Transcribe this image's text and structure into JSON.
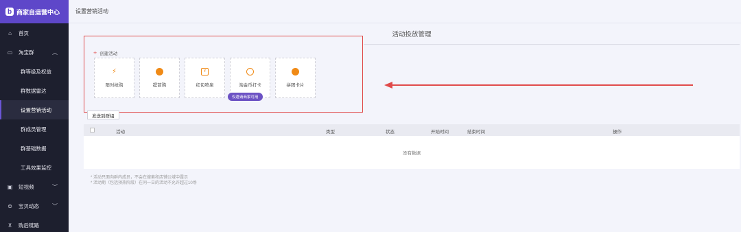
{
  "brand": {
    "logo_text": "b",
    "title": "商家自运营中心"
  },
  "sidebar": {
    "items": [
      {
        "icon": "home-icon",
        "glyph": "⌂",
        "label": "首页"
      },
      {
        "icon": "chat-icon",
        "glyph": "▭",
        "label": "淘宝群",
        "chevron": "︿"
      }
    ],
    "sub_items": [
      {
        "label": "群等级及权益"
      },
      {
        "label": "群数据雷达"
      },
      {
        "label": "设置营销活动",
        "active": true
      },
      {
        "label": "群成员管理"
      },
      {
        "label": "群基础数据"
      },
      {
        "label": "工具效果监控"
      }
    ],
    "bottom_items": [
      {
        "icon": "video-icon",
        "glyph": "▣",
        "label": "短视频",
        "chevron": "﹀"
      },
      {
        "icon": "lock-icon",
        "glyph": "⊜",
        "label": "宝贝动态",
        "chevron": "﹀"
      },
      {
        "icon": "cart-icon",
        "glyph": "⊻",
        "label": "购后链路"
      }
    ]
  },
  "topbar": {
    "breadcrumb": "设置营销活动"
  },
  "main": {
    "page_title": "活动投放管理",
    "create_label": "创建活动",
    "cards": [
      {
        "icon": "lightning-icon",
        "glyph": "⚡",
        "label": "限时抢购"
      },
      {
        "icon": "early-buy-icon",
        "glyph": "●",
        "label": "提前购"
      },
      {
        "icon": "red-packet-icon",
        "glyph": "¥",
        "label": "红包喷泉"
      },
      {
        "icon": "coin-checkin-icon",
        "glyph": "◌",
        "label": "淘金币打卡"
      },
      {
        "icon": "group-card-icon",
        "glyph": "⊜",
        "label": "拼团卡片"
      }
    ],
    "badge": "仅邀请商家可用",
    "send_button": "发送到群组",
    "table": {
      "columns": [
        "活动",
        "类型",
        "状态",
        "开始时间",
        "结束时间",
        "操作"
      ],
      "empty_text": "没有数据"
    },
    "notes": [
      "* 活动只面向群内成员，不会在搜索和店铺公域中露示",
      "* 活动期（包括预热阶段）在同一日的活动不允许超过10场"
    ]
  },
  "colors": {
    "accent": "#5e47c9",
    "sidebar_bg": "#1d1f2e",
    "highlight": "#e04a4a",
    "icon_orange": "#f08a16"
  }
}
